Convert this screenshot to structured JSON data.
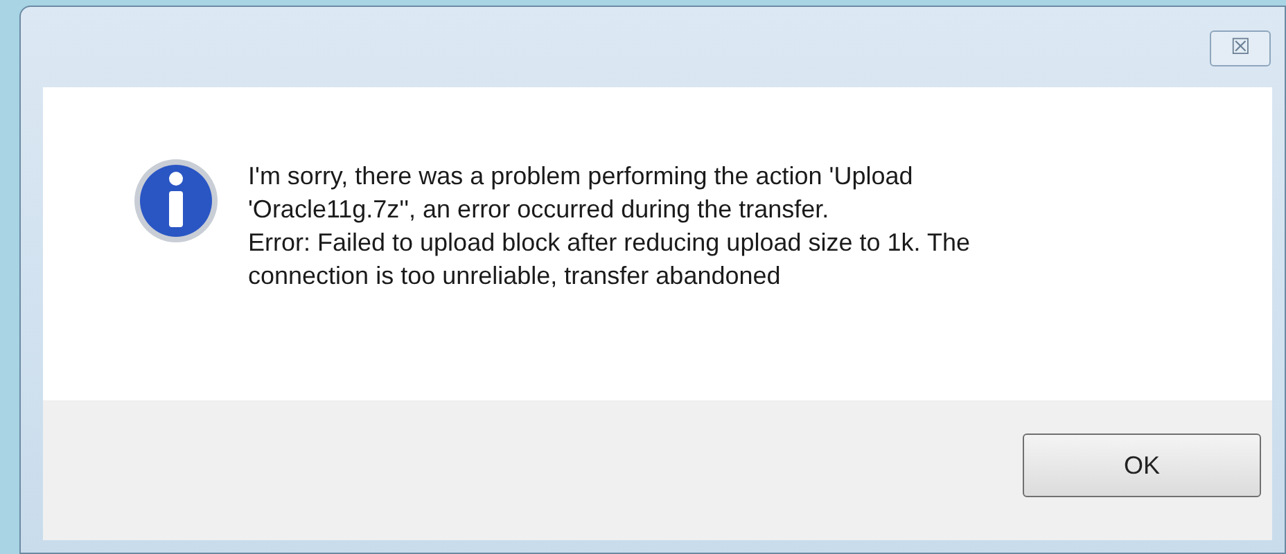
{
  "dialog": {
    "close_button": "☒",
    "message_lines": [
      "I'm sorry, there was a problem performing the action 'Upload",
      "'Oracle11g.7z'', an error occurred during the transfer.",
      "Error: Failed to upload block after reducing upload size to 1k. The",
      "connection is too unreliable, transfer abandoned"
    ],
    "buttons": [
      "OK"
    ]
  }
}
